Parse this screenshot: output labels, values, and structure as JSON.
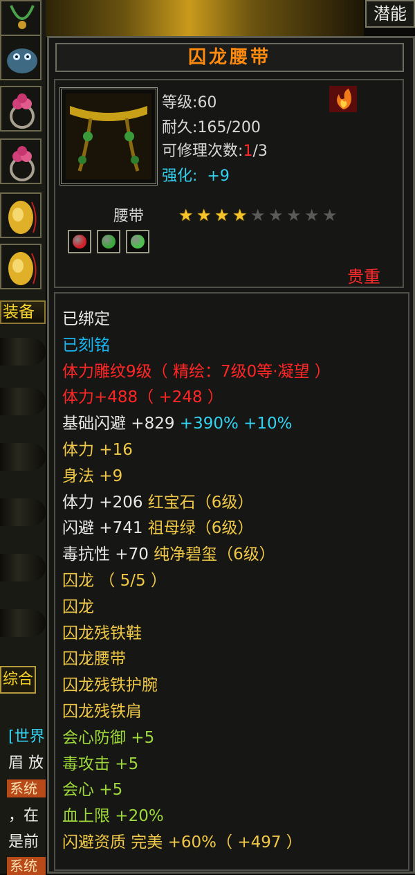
{
  "top": {
    "potential_tab": "潜能"
  },
  "left": {
    "equip_tab": "装备",
    "general_tab": "综合",
    "chat": [
      {
        "text": "[世界"
      },
      {
        "text": "眉 放"
      },
      {
        "text": "系统"
      },
      {
        "text": "，在"
      },
      {
        "text": "是前"
      },
      {
        "text": "系统"
      }
    ]
  },
  "item": {
    "name": "囚龙腰带",
    "level_label": "等级",
    "level": "60",
    "durability_label": "耐久",
    "durability": "165/200",
    "repair_label": "可修理次数",
    "repair_used": "1",
    "repair_total": "/3",
    "enhance_label": "强化",
    "enhance_value": "+9",
    "type": "腰带",
    "stars_filled": 4,
    "stars_total": 9,
    "rarity": "贵重",
    "gems": [
      {
        "color": "#d0202a",
        "icon": "ruby-gem-icon"
      },
      {
        "color": "#3aa83a",
        "icon": "emerald-gem-icon"
      },
      {
        "color": "#4cc04c",
        "icon": "jade-gem-icon"
      }
    ]
  },
  "attributes": [
    {
      "text": "已绑定",
      "color": "#e8e8e8"
    },
    {
      "text": "已刻铭",
      "color": "#18b4f0"
    },
    {
      "text": "体力雕纹9级（ 精绘：7级0等·凝望 ）",
      "color": "#ff2626"
    },
    {
      "text": "体力+488（ +248 ）",
      "color": "#ff2626"
    },
    {
      "text": "基础闪避  +829",
      "extra": " +390%  +10%",
      "color": "#e8e8e8",
      "extra_color": "#34d2f0"
    },
    {
      "text": "体力  +16",
      "color": "#f0c848"
    },
    {
      "text": "身法  +9",
      "color": "#f0c848"
    },
    {
      "text": "体力  +206",
      "extra": "  红宝石（6级）",
      "color": "#e8e8e8",
      "extra_color": "#f0c848"
    },
    {
      "text": "闪避  +741",
      "extra": "  祖母绿（6级）",
      "color": "#e8e8e8",
      "extra_color": "#f0c848"
    },
    {
      "text": "毒抗性  +70",
      "extra": "  纯净碧玺（6级）",
      "color": "#e8e8e8",
      "extra_color": "#f0c848"
    },
    {
      "text": "囚龙  （ 5/5 ）",
      "color": "#f0c848"
    },
    {
      "text": "囚龙",
      "color": "#f0c848"
    },
    {
      "text": "囚龙残铁鞋",
      "color": "#f0c848"
    },
    {
      "text": "囚龙腰带",
      "color": "#f0c848"
    },
    {
      "text": "囚龙残铁护腕",
      "color": "#f0c848"
    },
    {
      "text": "囚龙残铁肩",
      "color": "#f0c848"
    },
    {
      "text": "会心防御  +5",
      "color": "#9ed83a"
    },
    {
      "text": "毒攻击  +5",
      "color": "#9ed83a"
    },
    {
      "text": "会心  +5",
      "color": "#9ed83a"
    },
    {
      "text": "血上限  +20%",
      "color": "#9ed83a"
    },
    {
      "text": "闪避资质    完美  +60%（ +497 ）",
      "color": "#f0c848"
    }
  ]
}
